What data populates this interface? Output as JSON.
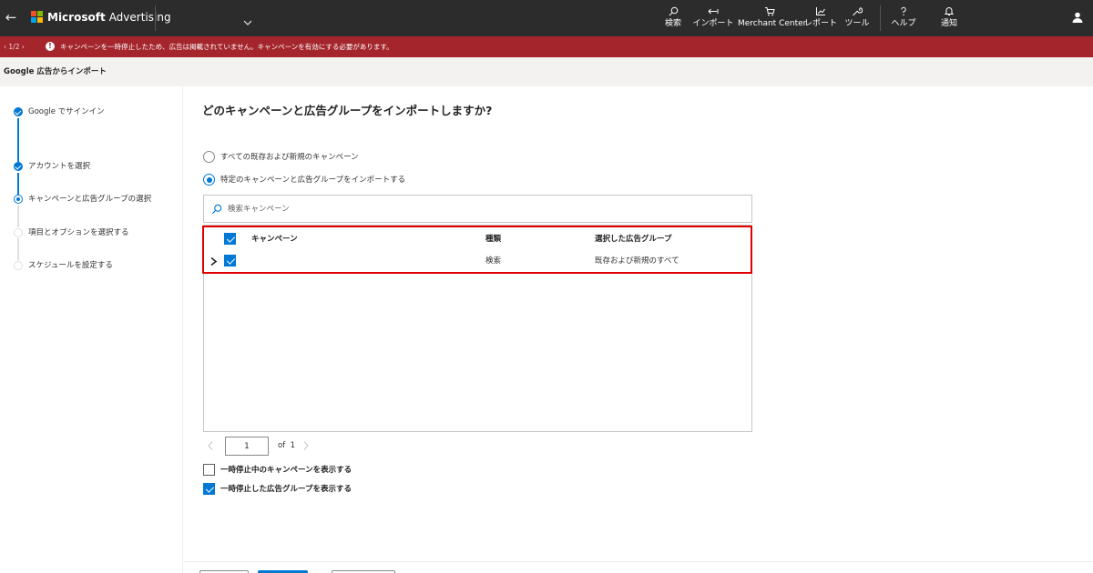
{
  "topbar": {
    "brand_bold": "Microsoft",
    "brand_rest": "Advertising",
    "nav": [
      {
        "label": "検索",
        "icon": "search-icon"
      },
      {
        "label": "インポート",
        "icon": "import-icon"
      },
      {
        "label": "Merchant Center",
        "icon": "cart-icon"
      },
      {
        "label": "レポート",
        "icon": "chart-icon"
      },
      {
        "label": "ツール",
        "icon": "wrench-icon"
      },
      {
        "label": "ヘルプ",
        "icon": "help-icon"
      },
      {
        "label": "通知",
        "icon": "bell-icon"
      }
    ]
  },
  "alert": {
    "pager_current": "1",
    "pager_sep": "/",
    "pager_total": "2",
    "message": "キャンペーンを一時停止したため、広告は掲載されていません。キャンペーンを有効にする必要があります。",
    "color": "#a4262c"
  },
  "page": {
    "title": "Google 広告からインポート"
  },
  "stepper": {
    "steps": [
      {
        "label": "Google でサインイン",
        "state": "done"
      },
      {
        "label": "アカウントを選択",
        "state": "done"
      },
      {
        "label": "キャンペーンと広告グループの選択",
        "state": "current"
      },
      {
        "label": "項目とオプションを選択する",
        "state": "todo"
      },
      {
        "label": "スケジュールを設定する",
        "state": "todo"
      }
    ]
  },
  "main": {
    "heading": "どのキャンペーンと広告グループをインポートしますか?",
    "radio_all": "すべての既存および新規のキャンペーン",
    "radio_specific": "特定のキャンペーンと広告グループをインポートする",
    "search_placeholder": "検索キャンペーン",
    "table": {
      "headers": {
        "campaign": "キャンペーン",
        "type": "種類",
        "ad_groups": "選択した広告グループ"
      },
      "rows": [
        {
          "campaign": "",
          "type": "検索",
          "ad_groups": "既存および新規のすべて",
          "checked": true
        }
      ]
    },
    "pagination": {
      "page": "1",
      "of_label": "of",
      "total": "1"
    },
    "options": [
      {
        "label": "一時停止中のキャンペーンを表示する",
        "checked": false
      },
      {
        "label": "一時停止した広告グループを表示する",
        "checked": true
      }
    ]
  },
  "colors": {
    "accent": "#0078d4",
    "topbar": "#2c2c2c",
    "highlight": "#e00000"
  }
}
